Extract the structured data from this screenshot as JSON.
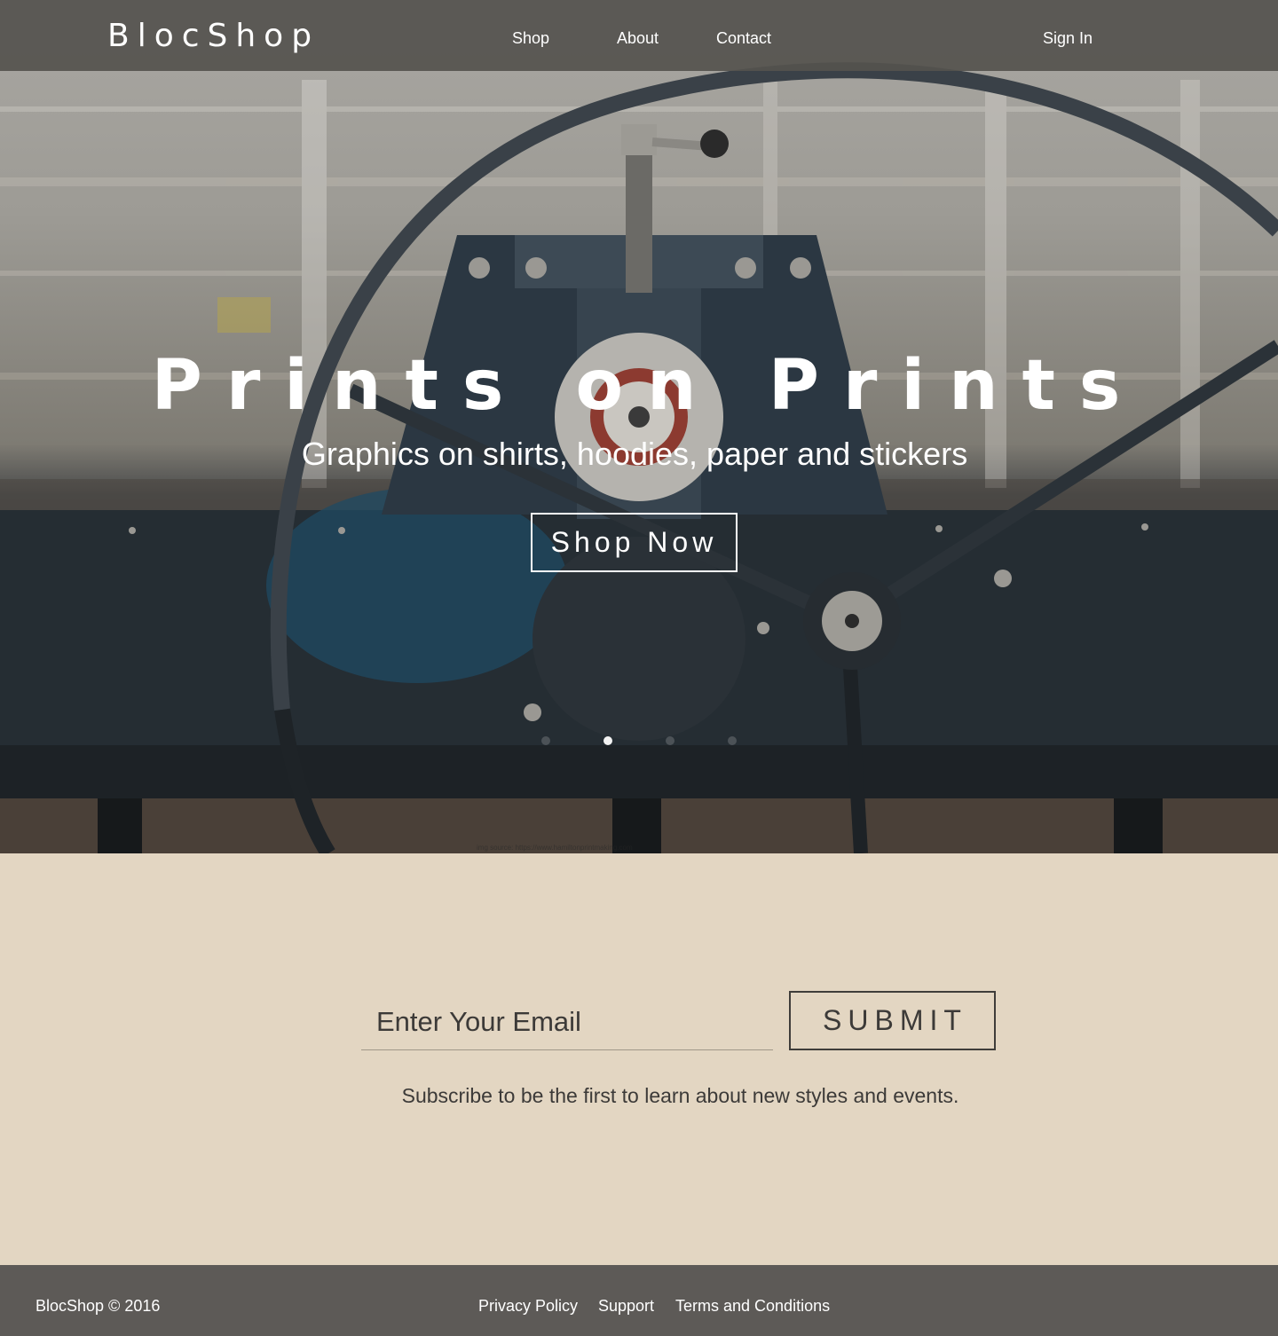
{
  "nav": {
    "logo": "BlocShop",
    "links": [
      "Shop",
      "About",
      "Contact"
    ],
    "sign_in": "Sign In"
  },
  "hero": {
    "title": "Prints on Prints",
    "subtitle": "Graphics on shirts, hoodies, paper and stickers",
    "cta": "Shop Now",
    "carousel": {
      "slide_count": 4,
      "active_index": 1
    },
    "img_source": "img source: https://www.hamiltonprintmaking.com"
  },
  "subscribe": {
    "email_placeholder": "Enter Your Email",
    "submit_label": "SUBMIT",
    "text": "Subscribe to be the first to learn about new styles and events."
  },
  "footer": {
    "copyright": "BlocShop © 2016",
    "links": [
      "Privacy Policy",
      "Support",
      "Terms and Conditions"
    ]
  },
  "colors": {
    "nav_bg": "#55524e",
    "page_bg": "#e3d6c2",
    "footer_bg": "#5d5a57",
    "text_dark": "#3c3a38"
  }
}
